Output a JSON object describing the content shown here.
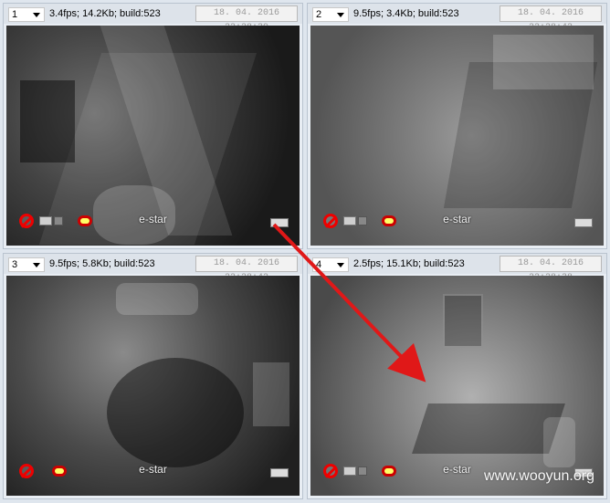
{
  "panels": [
    {
      "channel": "1",
      "stats": "3.4fps; 14.2Kb; build:523",
      "timestamp": "18. 04. 2016  22:28:39",
      "brand": "e-star"
    },
    {
      "channel": "2",
      "stats": "9.5fps; 3.4Kb; build:523",
      "timestamp": "18. 04. 2016  22:28:42",
      "brand": "e-star"
    },
    {
      "channel": "3",
      "stats": "9.5fps; 5.8Kb; build:523",
      "timestamp": "18. 04. 2016  22:28:42",
      "brand": "e-star"
    },
    {
      "channel": "4",
      "stats": "2.5fps; 15.1Kb; build:523",
      "timestamp": "18. 04. 2016  22:28:38",
      "brand": "e-star"
    }
  ],
  "watermark": "www.wooyun.org",
  "colors": {
    "arrow": "#e01818",
    "panel_bg": "#e9eef4",
    "header_bg": "#dde3ea"
  },
  "icons": [
    "no-audio-icon",
    "camera-icon",
    "record-icon",
    "disk-icon",
    "dropdown-arrow-icon"
  ]
}
